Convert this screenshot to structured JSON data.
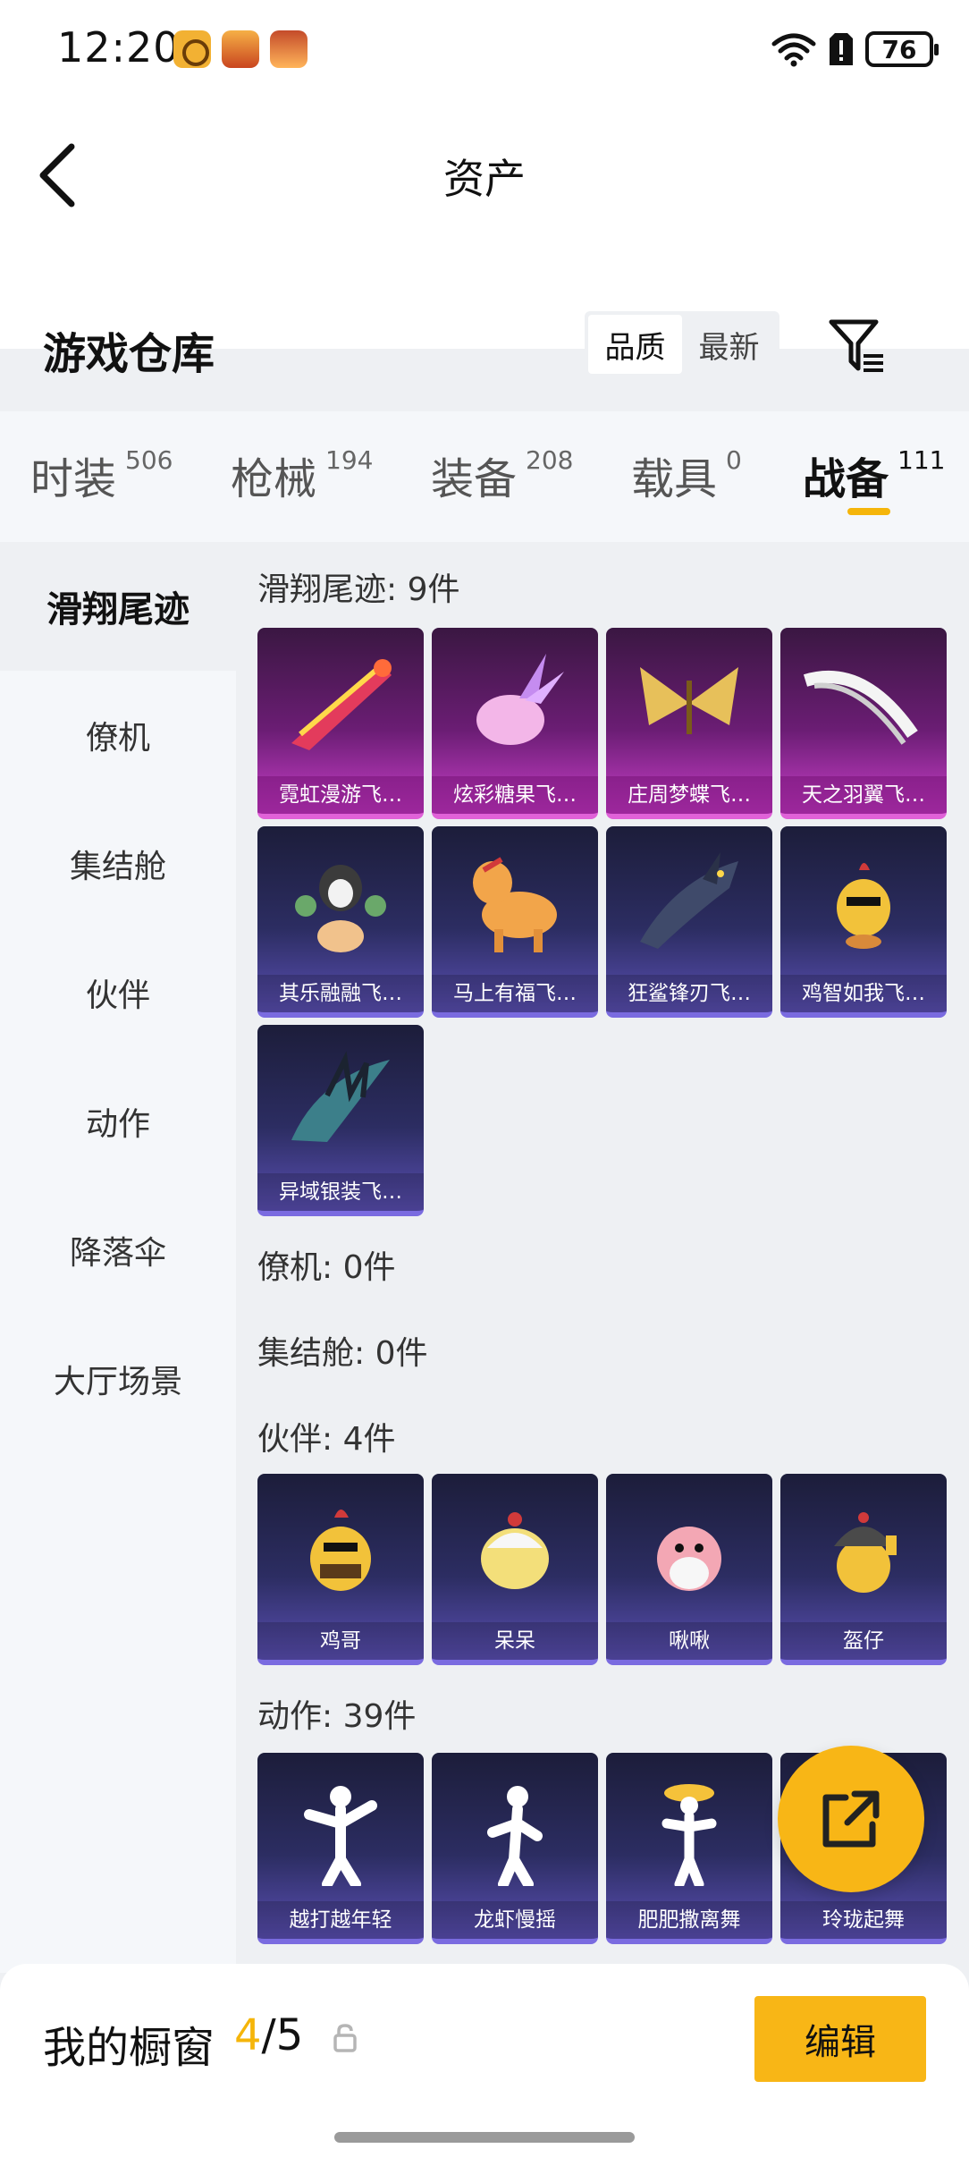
{
  "status_bar": {
    "time": "12:20",
    "battery": "76"
  },
  "header": {
    "title": "资产",
    "warehouse_title": "游戏仓库"
  },
  "sort": {
    "options": [
      "品质",
      "最新"
    ],
    "active": "品质"
  },
  "category_tabs": [
    {
      "label": "时装",
      "count": "506"
    },
    {
      "label": "枪械",
      "count": "194"
    },
    {
      "label": "装备",
      "count": "208"
    },
    {
      "label": "载具",
      "count": "0"
    },
    {
      "label": "战备",
      "count": "111",
      "active": true
    }
  ],
  "sidebar": {
    "items": [
      "滑翔尾迹",
      "僚机",
      "集结舱",
      "伙伴",
      "动作",
      "降落伞",
      "大厅场景"
    ],
    "active": "滑翔尾迹"
  },
  "sections": {
    "trail": {
      "title": "滑翔尾迹: 9件",
      "items": [
        {
          "name": "霓虹漫游飞…",
          "rarity": "purple"
        },
        {
          "name": "炫彩糖果飞…",
          "rarity": "purple"
        },
        {
          "name": "庄周梦蝶飞…",
          "rarity": "purple"
        },
        {
          "name": "天之羽翼飞…",
          "rarity": "purple"
        },
        {
          "name": "其乐融融飞…",
          "rarity": "blue"
        },
        {
          "name": "马上有福飞…",
          "rarity": "blue"
        },
        {
          "name": "狂鲨锋刃飞…",
          "rarity": "blue"
        },
        {
          "name": "鸡智如我飞…",
          "rarity": "blue"
        },
        {
          "name": "异域银装飞…",
          "rarity": "blue"
        }
      ]
    },
    "wingman": {
      "title": "僚机: 0件"
    },
    "pod": {
      "title": "集结舱: 0件"
    },
    "companion": {
      "title": "伙伴: 4件",
      "items": [
        {
          "name": "鸡哥"
        },
        {
          "name": "呆呆"
        },
        {
          "name": "啾啾"
        },
        {
          "name": "盔仔"
        }
      ]
    },
    "emote": {
      "title": "动作: 39件",
      "items": [
        {
          "name": "越打越年轻"
        },
        {
          "name": "龙虾慢摇"
        },
        {
          "name": "肥肥撒离舞"
        },
        {
          "name": "玲珑起舞"
        }
      ]
    }
  },
  "showcase": {
    "label": "我的橱窗",
    "current": "4",
    "total": "/5",
    "edit_label": "编辑"
  },
  "colors": {
    "accent": "#f8b616",
    "purple_rarity": "#c93fc9",
    "blue_rarity": "#5a4fb3"
  }
}
